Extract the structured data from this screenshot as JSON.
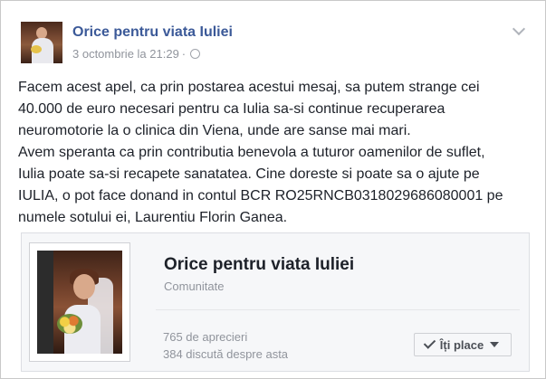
{
  "post": {
    "author": "Orice pentru viata Iuliei",
    "timestamp": "3 octombrie la 21:29",
    "separator": "·",
    "body_lines": [
      "Facem acest apel, ca prin postarea acestui mesaj, sa putem strange cei",
      "40.000 de euro necesari pentru ca Iulia sa-si continue recuperarea",
      "neuromotorie la o clinica din Viena, unde are sanse mai mari.",
      "Avem speranta ca prin contributia benevola a tuturor oamenilor de suflet,",
      "Iulia poate sa-si recapete sanatatea. Cine doreste si poate sa o ajute pe",
      "IULIA, o pot face donand in contul BCR RO25RNCB0318029686080001 pe",
      "numele sotului ei, Laurentiu Florin Ganea."
    ]
  },
  "attachment": {
    "title": "Orice pentru viata Iuliei",
    "subtitle": "Comunitate",
    "likes": "765 de aprecieri",
    "talking": "384 discută despre asta",
    "like_button_label": "Îți place"
  },
  "icons": {
    "post_options": "chevron-down-icon",
    "audience": "globe-icon",
    "liked": "check-icon",
    "dropdown": "caret-icon"
  },
  "colors": {
    "link": "#3b5998",
    "text": "#1d2129",
    "meta": "#90949c"
  }
}
